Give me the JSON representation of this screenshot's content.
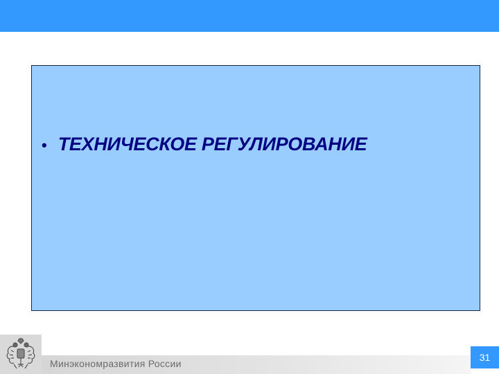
{
  "slide": {
    "bullet_glyph": "•",
    "bullet_text": "ТЕХНИЧЕСКОЕ РЕГУЛИРОВАНИЕ"
  },
  "footer": {
    "ministry": "Минэкономразвития России",
    "page_number": "31",
    "emblem_icon": "double-headed-eagle-emblem-icon"
  },
  "colors": {
    "top_bar": "#3399ff",
    "content_box": "#99ccff",
    "text": "#000080",
    "page_badge": "#3399ff"
  }
}
